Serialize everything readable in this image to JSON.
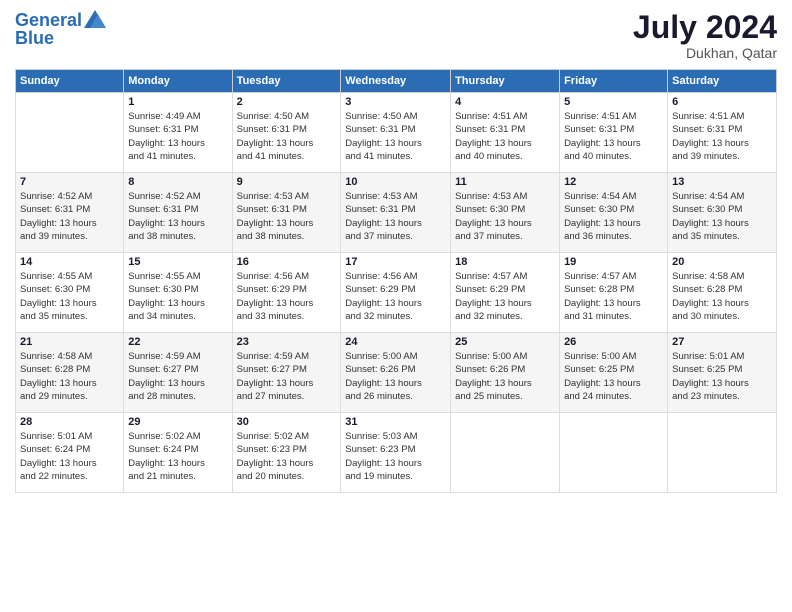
{
  "header": {
    "logo_line1": "General",
    "logo_line2": "Blue",
    "month": "July 2024",
    "location": "Dukhan, Qatar"
  },
  "days_of_week": [
    "Sunday",
    "Monday",
    "Tuesday",
    "Wednesday",
    "Thursday",
    "Friday",
    "Saturday"
  ],
  "weeks": [
    [
      {
        "day": "",
        "info": ""
      },
      {
        "day": "1",
        "info": "Sunrise: 4:49 AM\nSunset: 6:31 PM\nDaylight: 13 hours\nand 41 minutes."
      },
      {
        "day": "2",
        "info": "Sunrise: 4:50 AM\nSunset: 6:31 PM\nDaylight: 13 hours\nand 41 minutes."
      },
      {
        "day": "3",
        "info": "Sunrise: 4:50 AM\nSunset: 6:31 PM\nDaylight: 13 hours\nand 41 minutes."
      },
      {
        "day": "4",
        "info": "Sunrise: 4:51 AM\nSunset: 6:31 PM\nDaylight: 13 hours\nand 40 minutes."
      },
      {
        "day": "5",
        "info": "Sunrise: 4:51 AM\nSunset: 6:31 PM\nDaylight: 13 hours\nand 40 minutes."
      },
      {
        "day": "6",
        "info": "Sunrise: 4:51 AM\nSunset: 6:31 PM\nDaylight: 13 hours\nand 39 minutes."
      }
    ],
    [
      {
        "day": "7",
        "info": "Sunrise: 4:52 AM\nSunset: 6:31 PM\nDaylight: 13 hours\nand 39 minutes."
      },
      {
        "day": "8",
        "info": "Sunrise: 4:52 AM\nSunset: 6:31 PM\nDaylight: 13 hours\nand 38 minutes."
      },
      {
        "day": "9",
        "info": "Sunrise: 4:53 AM\nSunset: 6:31 PM\nDaylight: 13 hours\nand 38 minutes."
      },
      {
        "day": "10",
        "info": "Sunrise: 4:53 AM\nSunset: 6:31 PM\nDaylight: 13 hours\nand 37 minutes."
      },
      {
        "day": "11",
        "info": "Sunrise: 4:53 AM\nSunset: 6:30 PM\nDaylight: 13 hours\nand 37 minutes."
      },
      {
        "day": "12",
        "info": "Sunrise: 4:54 AM\nSunset: 6:30 PM\nDaylight: 13 hours\nand 36 minutes."
      },
      {
        "day": "13",
        "info": "Sunrise: 4:54 AM\nSunset: 6:30 PM\nDaylight: 13 hours\nand 35 minutes."
      }
    ],
    [
      {
        "day": "14",
        "info": "Sunrise: 4:55 AM\nSunset: 6:30 PM\nDaylight: 13 hours\nand 35 minutes."
      },
      {
        "day": "15",
        "info": "Sunrise: 4:55 AM\nSunset: 6:30 PM\nDaylight: 13 hours\nand 34 minutes."
      },
      {
        "day": "16",
        "info": "Sunrise: 4:56 AM\nSunset: 6:29 PM\nDaylight: 13 hours\nand 33 minutes."
      },
      {
        "day": "17",
        "info": "Sunrise: 4:56 AM\nSunset: 6:29 PM\nDaylight: 13 hours\nand 32 minutes."
      },
      {
        "day": "18",
        "info": "Sunrise: 4:57 AM\nSunset: 6:29 PM\nDaylight: 13 hours\nand 32 minutes."
      },
      {
        "day": "19",
        "info": "Sunrise: 4:57 AM\nSunset: 6:28 PM\nDaylight: 13 hours\nand 31 minutes."
      },
      {
        "day": "20",
        "info": "Sunrise: 4:58 AM\nSunset: 6:28 PM\nDaylight: 13 hours\nand 30 minutes."
      }
    ],
    [
      {
        "day": "21",
        "info": "Sunrise: 4:58 AM\nSunset: 6:28 PM\nDaylight: 13 hours\nand 29 minutes."
      },
      {
        "day": "22",
        "info": "Sunrise: 4:59 AM\nSunset: 6:27 PM\nDaylight: 13 hours\nand 28 minutes."
      },
      {
        "day": "23",
        "info": "Sunrise: 4:59 AM\nSunset: 6:27 PM\nDaylight: 13 hours\nand 27 minutes."
      },
      {
        "day": "24",
        "info": "Sunrise: 5:00 AM\nSunset: 6:26 PM\nDaylight: 13 hours\nand 26 minutes."
      },
      {
        "day": "25",
        "info": "Sunrise: 5:00 AM\nSunset: 6:26 PM\nDaylight: 13 hours\nand 25 minutes."
      },
      {
        "day": "26",
        "info": "Sunrise: 5:00 AM\nSunset: 6:25 PM\nDaylight: 13 hours\nand 24 minutes."
      },
      {
        "day": "27",
        "info": "Sunrise: 5:01 AM\nSunset: 6:25 PM\nDaylight: 13 hours\nand 23 minutes."
      }
    ],
    [
      {
        "day": "28",
        "info": "Sunrise: 5:01 AM\nSunset: 6:24 PM\nDaylight: 13 hours\nand 22 minutes."
      },
      {
        "day": "29",
        "info": "Sunrise: 5:02 AM\nSunset: 6:24 PM\nDaylight: 13 hours\nand 21 minutes."
      },
      {
        "day": "30",
        "info": "Sunrise: 5:02 AM\nSunset: 6:23 PM\nDaylight: 13 hours\nand 20 minutes."
      },
      {
        "day": "31",
        "info": "Sunrise: 5:03 AM\nSunset: 6:23 PM\nDaylight: 13 hours\nand 19 minutes."
      },
      {
        "day": "",
        "info": ""
      },
      {
        "day": "",
        "info": ""
      },
      {
        "day": "",
        "info": ""
      }
    ]
  ]
}
